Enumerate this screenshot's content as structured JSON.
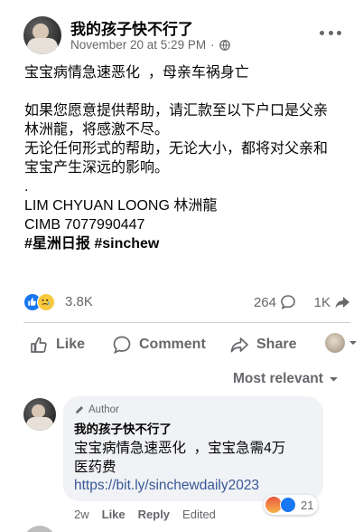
{
  "post": {
    "author": "我的孩子快不行了",
    "timestamp": "November 20 at 5:29 PM",
    "separator": "·",
    "audience_icon": "globe-icon",
    "more_icon": "more-options-icon",
    "lines": [
      "宝宝病情急速恶化  ，母亲车祸身亡",
      "",
      "如果您愿意提供帮助，请汇款至以下户口是父亲",
      "林洲龍，将感激不尽。",
      "无论任何形式的帮助，无论大小，都将对父亲和",
      "宝宝产生深远的影响。",
      ".",
      "LIM CHYUAN LOONG 林洲龍",
      "CIMB 7077990447"
    ],
    "hashtags": "#星洲日报 #sinchew"
  },
  "stats": {
    "reactions_count": "3.8K",
    "comments_count": "264",
    "shares_count": "1K"
  },
  "actions": {
    "like": "Like",
    "comment": "Comment",
    "share": "Share"
  },
  "sort": {
    "label": "Most relevant"
  },
  "comment": {
    "badge": "Author",
    "author": "我的孩子快不行了",
    "text_lines": [
      "宝宝病情急速恶化  ，宝宝急需4万",
      "医药费"
    ],
    "link": "https://bit.ly/sinchewdaily2023",
    "reaction_count": "21",
    "age": "2w",
    "like": "Like",
    "reply": "Reply",
    "edited": "Edited"
  },
  "colors": {
    "link": "#385898",
    "muted": "#65676b",
    "like_blue": "#1877f2",
    "bubble": "#f0f2f5"
  }
}
